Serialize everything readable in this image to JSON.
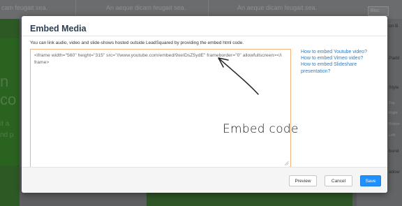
{
  "background": {
    "topbar_cells": [
      "cam feugait sea.",
      "An aeque dicam feugait sea.",
      "An aeque dicam feugait sea."
    ],
    "left_big": [
      "n",
      "co"
    ],
    "left_small": [
      "it a",
      "nd p"
    ],
    "right_labels": [
      "on B",
      "Padd",
      "Style"
    ],
    "right_items": [
      "Top",
      "Right",
      "Botton",
      "Left",
      "bund",
      "adow"
    ],
    "right_chip": "Bloc"
  },
  "modal": {
    "title": "Embed Media",
    "description": "You can link audio, video and slide-shows hosted outside LeadSquared by providing the embed html code.",
    "embed_code": "<iframe width=\"560\" height=\"315\" src=\"//www.youtube.com/embed/9xeIDsZ5ydE\" frameborder=\"0\" allowfullscreen></iframe>",
    "help_links": [
      "How to embed Youtube video?",
      "How to embed Vimeo video?",
      "How to embed Slideshare presentation?"
    ],
    "annotation": "Embed code",
    "buttons": {
      "preview": "Preview",
      "cancel": "Cancel",
      "save": "Save"
    }
  },
  "colors": {
    "save_button": "#1e90ff",
    "link": "#2a7fc9",
    "textarea_border": "#f5b27a",
    "title": "#2c3e50"
  },
  "icons": [
    "arrow-annotation-icon",
    "resize-grip-icon"
  ]
}
